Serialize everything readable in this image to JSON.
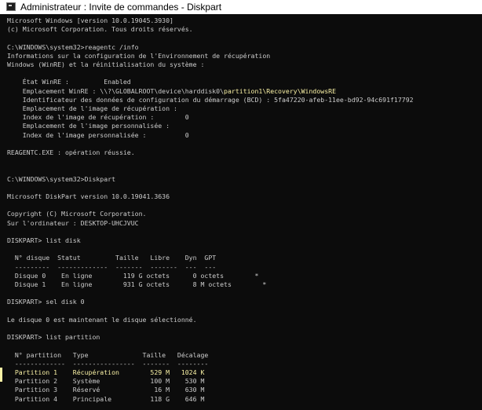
{
  "window": {
    "title": "Administrateur : Invite de commandes - Diskpart",
    "icon": "cmd-icon",
    "colors": {
      "background": "#0c0c0c",
      "text": "#cccccc",
      "highlight": "#f9f1a5"
    }
  },
  "console": {
    "lines": [
      {
        "segments": [
          {
            "text": "Microsoft Windows [version 10.0.19045.3930]"
          }
        ]
      },
      {
        "segments": [
          {
            "text": "(c) Microsoft Corporation. Tous droits réservés."
          }
        ]
      },
      {
        "segments": [
          {
            "text": ""
          }
        ]
      },
      {
        "segments": [
          {
            "text": "C:\\WINDOWS\\system32>reagentc /info"
          }
        ]
      },
      {
        "segments": [
          {
            "text": "Informations sur la configuration de l'Environnement de récupération"
          }
        ]
      },
      {
        "segments": [
          {
            "text": "Windows (WinRE) et la réinitialisation du système :"
          }
        ]
      },
      {
        "segments": [
          {
            "text": ""
          }
        ]
      },
      {
        "segments": [
          {
            "text": "    État WinRE :         Enabled"
          }
        ]
      },
      {
        "segments": [
          {
            "text": "    Emplacement WinRE : \\\\?\\GLOBALROOT\\device\\harddisk0\\"
          },
          {
            "text": "partition1\\Recovery\\WindowsRE",
            "highlight": true
          }
        ]
      },
      {
        "segments": [
          {
            "text": "    Identificateur des données de configuration du démarrage (BCD) : 5fa47220-afeb-11ee-bd92-94c691f17792"
          }
        ]
      },
      {
        "segments": [
          {
            "text": "    Emplacement de l'image de récupération :"
          }
        ]
      },
      {
        "segments": [
          {
            "text": "    Index de l'image de récupération :        0"
          }
        ]
      },
      {
        "segments": [
          {
            "text": "    Emplacement de l'image personnalisée :"
          }
        ]
      },
      {
        "segments": [
          {
            "text": "    Index de l'image personnalisée :          0"
          }
        ]
      },
      {
        "segments": [
          {
            "text": ""
          }
        ]
      },
      {
        "segments": [
          {
            "text": "REAGENTC.EXE : opération réussie."
          }
        ]
      },
      {
        "segments": [
          {
            "text": ""
          }
        ]
      },
      {
        "segments": [
          {
            "text": ""
          }
        ]
      },
      {
        "segments": [
          {
            "text": "C:\\WINDOWS\\system32>Diskpart"
          }
        ]
      },
      {
        "segments": [
          {
            "text": ""
          }
        ]
      },
      {
        "segments": [
          {
            "text": "Microsoft DiskPart version 10.0.19041.3636"
          }
        ]
      },
      {
        "segments": [
          {
            "text": ""
          }
        ]
      },
      {
        "segments": [
          {
            "text": "Copyright (C) Microsoft Corporation."
          }
        ]
      },
      {
        "segments": [
          {
            "text": "Sur l'ordinateur : DESKTOP-UHCJVUC"
          }
        ]
      },
      {
        "segments": [
          {
            "text": ""
          }
        ]
      },
      {
        "segments": [
          {
            "text": "DISKPART> list disk"
          }
        ]
      },
      {
        "segments": [
          {
            "text": ""
          }
        ]
      },
      {
        "segments": [
          {
            "text": "  N° disque  Statut         Taille   Libre    Dyn  GPT"
          }
        ]
      },
      {
        "segments": [
          {
            "text": "  ---------  -------------  -------  -------  ---  ---"
          }
        ]
      },
      {
        "segments": [
          {
            "text": "  Disque 0    En ligne        119 G octets      0 octets        *"
          }
        ]
      },
      {
        "segments": [
          {
            "text": "  Disque 1    En ligne        931 G octets      8 M octets        *"
          }
        ]
      },
      {
        "segments": [
          {
            "text": ""
          }
        ]
      },
      {
        "segments": [
          {
            "text": "DISKPART> sel disk 0"
          }
        ]
      },
      {
        "segments": [
          {
            "text": ""
          }
        ]
      },
      {
        "segments": [
          {
            "text": "Le disque 0 est maintenant le disque sélectionné."
          }
        ]
      },
      {
        "segments": [
          {
            "text": ""
          }
        ]
      },
      {
        "segments": [
          {
            "text": "DISKPART> list partition"
          }
        ]
      },
      {
        "segments": [
          {
            "text": ""
          }
        ]
      },
      {
        "segments": [
          {
            "text": "  N° partition   Type              Taille   Décalage"
          }
        ]
      },
      {
        "segments": [
          {
            "text": "  -------------  ----------------  -------  --------"
          }
        ]
      },
      {
        "segments": [
          {
            "text": "  Partition 1    Récupération        529 M   1024 K",
            "highlight": true
          }
        ]
      },
      {
        "segments": [
          {
            "text": "  Partition 2    Système             100 M    530 M"
          }
        ]
      },
      {
        "segments": [
          {
            "text": "  Partition 3    Réservé              16 M    630 M"
          }
        ]
      },
      {
        "segments": [
          {
            "text": "  Partition 4    Principale          118 G    646 M"
          }
        ]
      }
    ]
  }
}
